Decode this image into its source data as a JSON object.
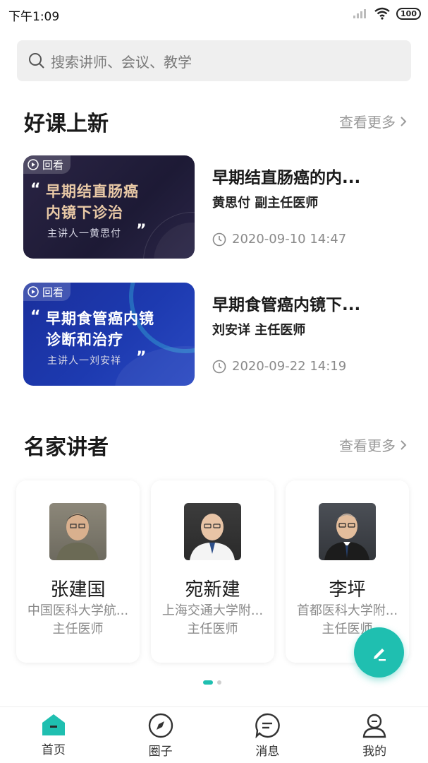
{
  "status_bar": {
    "time": "下午1:09",
    "battery": "100"
  },
  "search": {
    "placeholder": "搜索讲师、会议、教学"
  },
  "sections": {
    "new_courses": {
      "title": "好课上新",
      "see_more": "查看更多"
    },
    "experts": {
      "title": "名家讲者",
      "see_more": "查看更多"
    }
  },
  "courses": [
    {
      "tag": "回看",
      "thumb_line1": "早期结直肠癌",
      "thumb_line2": "内镜下诊治",
      "thumb_speaker": "主讲人一黄思付",
      "title": "早期结直肠癌的内...",
      "teacher": "黄思付 副主任医师",
      "time": "2020-09-10 14:47"
    },
    {
      "tag": "回看",
      "thumb_line1": "早期食管癌内镜",
      "thumb_line2": "诊断和治疗",
      "thumb_speaker": "主讲人一刘安祥",
      "title": "早期食管癌内镜下...",
      "teacher": "刘安详 主任医师",
      "time": "2020-09-22 14:19"
    }
  ],
  "experts": [
    {
      "name": "张建国",
      "org": "中国医科大学航...",
      "title": "主任医师"
    },
    {
      "name": "宛新建",
      "org": "上海交通大学附...",
      "title": "主任医师"
    },
    {
      "name": "李坪",
      "org": "首都医科大学附...",
      "title": "主任医师"
    }
  ],
  "bottom_nav": [
    {
      "label": "首页",
      "icon": "home-icon",
      "active": true
    },
    {
      "label": "圈子",
      "icon": "compass-icon",
      "active": false
    },
    {
      "label": "消息",
      "icon": "chat-icon",
      "active": false
    },
    {
      "label": "我的",
      "icon": "person-icon",
      "active": false
    }
  ],
  "colors": {
    "accent": "#1fbfb0"
  }
}
